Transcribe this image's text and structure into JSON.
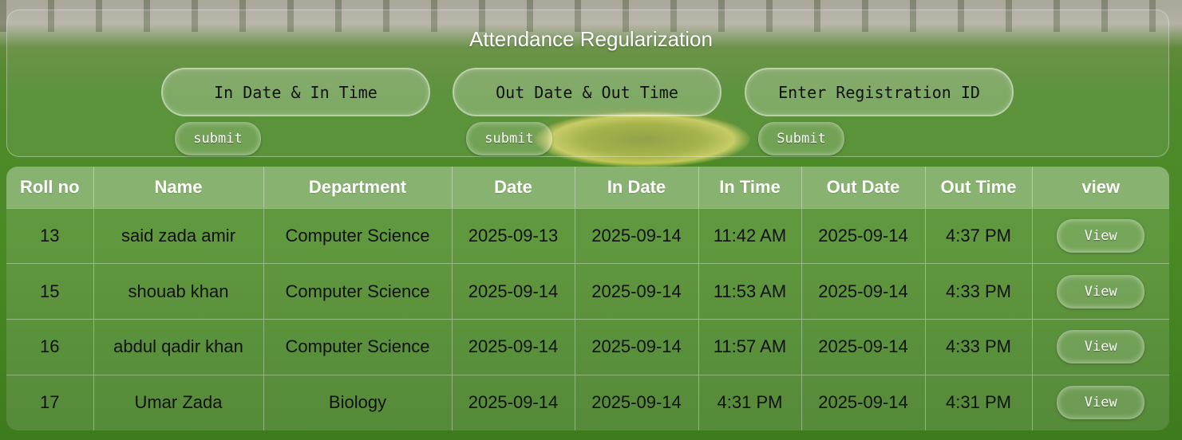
{
  "page": {
    "title": "Attendance Regularization"
  },
  "filters": [
    {
      "placeholder": "In Date & In Time",
      "submit_label": "submit"
    },
    {
      "placeholder": "Out Date & Out Time",
      "submit_label": "submit"
    },
    {
      "placeholder": "Enter Registration ID",
      "submit_label": "Submit"
    }
  ],
  "table": {
    "headers": [
      "Roll no",
      "Name",
      "Department",
      "Date",
      "In Date",
      "In Time",
      "Out Date",
      "Out Time",
      "view"
    ],
    "rows": [
      {
        "roll": "13",
        "name": "said zada amir",
        "department": "Computer Science",
        "date": "2025-09-13",
        "in_date": "2025-09-14",
        "in_time": "11:42 AM",
        "out_date": "2025-09-14",
        "out_time": "4:37 PM",
        "action": "View"
      },
      {
        "roll": "15",
        "name": "shouab khan",
        "department": "Computer Science",
        "date": "2025-09-14",
        "in_date": "2025-09-14",
        "in_time": "11:53 AM",
        "out_date": "2025-09-14",
        "out_time": "4:33 PM",
        "action": "View"
      },
      {
        "roll": "16",
        "name": "abdul qadir khan",
        "department": "Computer Science",
        "date": "2025-09-14",
        "in_date": "2025-09-14",
        "in_time": "11:57 AM",
        "out_date": "2025-09-14",
        "out_time": "4:33 PM",
        "action": "View"
      },
      {
        "roll": "17",
        "name": "Umar Zada",
        "department": "Biology",
        "date": "2025-09-14",
        "in_date": "2025-09-14",
        "in_time": "4:31 PM",
        "out_date": "2025-09-14",
        "out_time": "4:31 PM",
        "action": "View"
      }
    ]
  }
}
